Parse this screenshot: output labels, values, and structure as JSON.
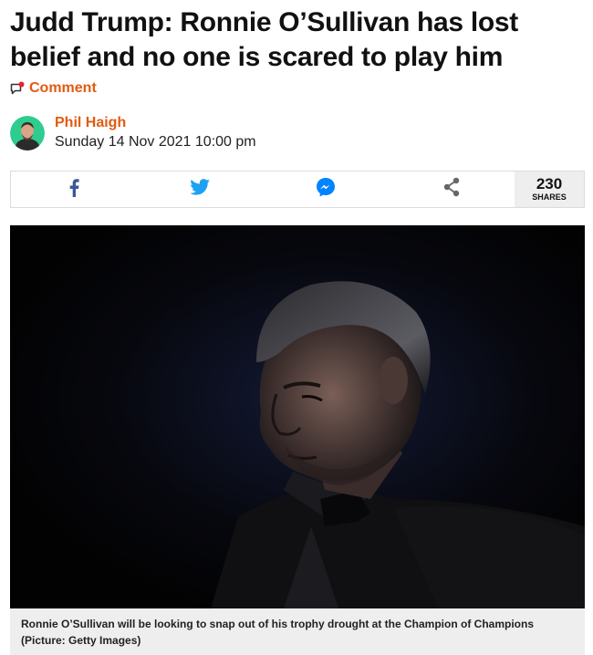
{
  "article": {
    "headline": "Judd Trump: Ronnie O’Sullivan has lost belief and no one is scared to play him",
    "comment_label": "Comment",
    "author": "Phil Haigh",
    "date": "Sunday 14 Nov 2021 10:00 pm"
  },
  "share": {
    "buttons": [
      "facebook-icon",
      "twitter-icon",
      "messenger-icon",
      "share-icon"
    ],
    "count": "230",
    "count_label": "SHARES",
    "colors": {
      "facebook": "#3b5998",
      "twitter": "#1da1f2",
      "messenger": "#0084ff",
      "share": "#666666"
    }
  },
  "figure": {
    "caption": "Ronnie O’Sullivan will be looking to snap out of his trophy drought at the Champion of Champions (Picture: Getty Images)"
  },
  "colors": {
    "accent": "#e35a10",
    "caption_bg": "#eeeeee"
  }
}
